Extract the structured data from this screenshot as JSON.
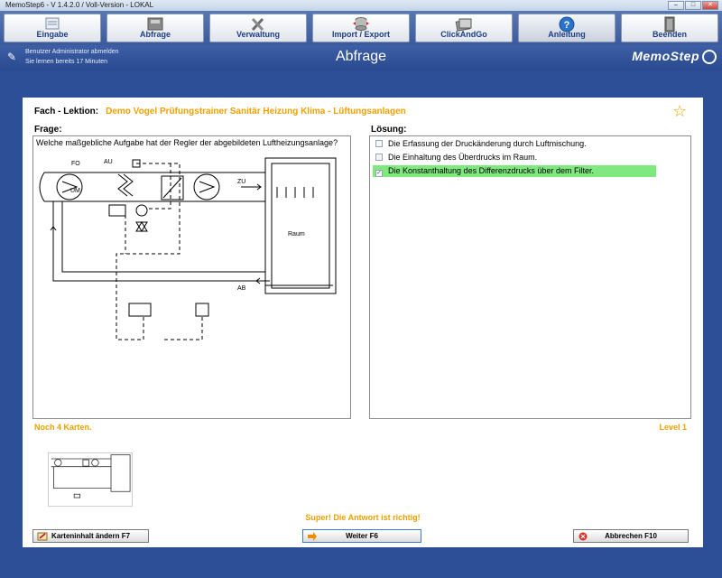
{
  "window": {
    "title": "MemoStep6 - V 1.4.2.0  /  Voll-Version  -  LOKAL",
    "controls": [
      "–",
      "□",
      "✕"
    ]
  },
  "toolbar": {
    "buttons": [
      {
        "label": "Eingabe",
        "icon": "input-form-icon"
      },
      {
        "label": "Abfrage",
        "icon": "query-box-icon"
      },
      {
        "label": "Verwaltung",
        "icon": "tools-icon"
      },
      {
        "label": "Import / Export",
        "icon": "database-arrows-icon"
      },
      {
        "label": "ClickAndGo",
        "icon": "cards-icon"
      },
      {
        "label": "Anleitung",
        "icon": "help-icon"
      },
      {
        "label": "Beenden",
        "icon": "exit-door-icon"
      }
    ]
  },
  "header": {
    "logout": "Benutzer Administrator abmelden",
    "learning_time": "Sie lernen bereits 17 Minuten",
    "title": "Abfrage",
    "logo": "MemoStep"
  },
  "lesson": {
    "label": "Fach - Lektion:",
    "value": "Demo Vogel Prüfungstrainer Sanitär Heizung Klima - Lüftungsanlagen"
  },
  "question": {
    "label": "Frage:",
    "text": "Welche maßgebliche Aufgabe hat der Regler der abgebildeten Luftheizungsanlage?",
    "diagram_labels": {
      "fo": "FO",
      "au": "AU",
      "um": "UM",
      "zu": "ZU",
      "raum": "Raum",
      "ab": "AB"
    }
  },
  "solution": {
    "label": "Lösung:",
    "answers": [
      {
        "text": "Die Erfassung der Druckänderung durch Luftmischung.",
        "checked": false
      },
      {
        "text": "Die Einhaltung des Überdrucks im Raum.",
        "checked": false
      },
      {
        "text": "Die Konstanthaltung des Differenzdrucks über dem Filter.",
        "checked": true
      }
    ],
    "check_mark": "✓"
  },
  "status": {
    "cards_left": "Noch 4 Karten.",
    "level": "Level 1",
    "feedback": "Super! Die Antwort ist richtig!"
  },
  "buttons": {
    "edit": "Karteninhalt ändern  F7",
    "next": "Weiter  F6",
    "cancel": "Abbrechen  F10"
  },
  "colors": {
    "background": "#2d4f97",
    "accent_orange": "#e8a000",
    "correct_green": "#7fe87f",
    "toolbar_text": "#1e3e82"
  }
}
